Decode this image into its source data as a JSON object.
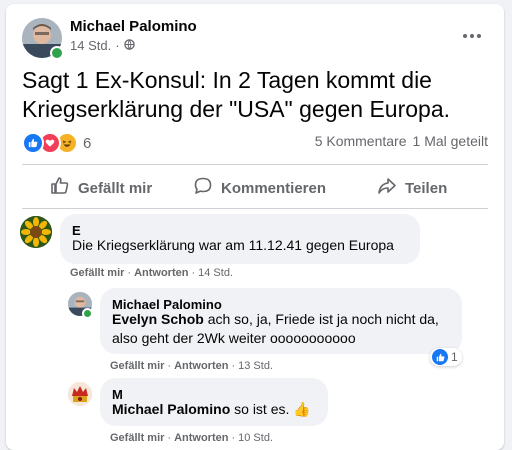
{
  "post": {
    "author": "Michael Palomino",
    "time": "14 Std.",
    "privacy_icon": "globe-icon",
    "text": "Sagt 1 Ex-Konsul: In 2 Tagen kommt die Kriegserklärung der \"USA\" gegen Europa.",
    "reaction_icons": [
      "like-icon",
      "love-icon",
      "haha-icon"
    ],
    "reaction_count": "6",
    "comments_count": "5 Kommentare",
    "shares_count": "1 Mal geteilt"
  },
  "actions": {
    "like": "Gefällt mir",
    "comment": "Kommentieren",
    "share": "Teilen"
  },
  "comments": [
    {
      "author": "E",
      "text": "Die Kriegserklärung war am 11.12.41 gegen Europa",
      "like_label": "Gefällt mir",
      "reply_label": "Antworten",
      "time": "14 Std."
    },
    {
      "author": "Michael Palomino",
      "mention": "Evelyn Schob",
      "text": "ach so, ja, Friede ist ja noch nicht da, also geht der 2Wk weiter ooooooooooo",
      "like_label": "Gefällt mir",
      "reply_label": "Antworten",
      "time": "13 Std.",
      "like_count": "1"
    },
    {
      "author": "M",
      "mention": "Michael Palomino",
      "text": "so ist es.",
      "emoji": "👍",
      "like_label": "Gefällt mir",
      "reply_label": "Antworten",
      "time": "10 Std."
    }
  ],
  "colors": {
    "accent": "#1877f2",
    "secondary_text": "#65676b",
    "bubble": "#f0f2f5",
    "online": "#31a24c"
  }
}
